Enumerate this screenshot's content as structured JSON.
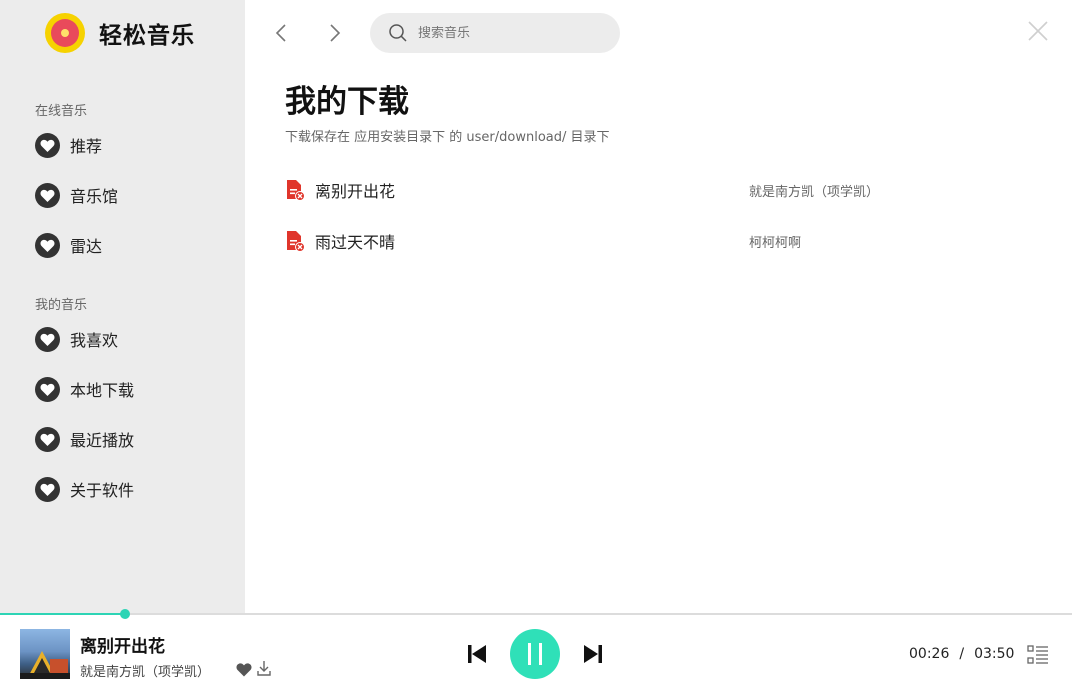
{
  "app": {
    "name": "轻松音乐"
  },
  "sidebar": {
    "online_section": "在线音乐",
    "online_items": [
      {
        "label": "推荐",
        "icon": "heart-icon"
      },
      {
        "label": "音乐馆",
        "icon": "heart-icon"
      },
      {
        "label": "雷达",
        "icon": "heart-icon"
      }
    ],
    "my_section": "我的音乐",
    "my_items": [
      {
        "label": "我喜欢",
        "icon": "heart-icon"
      },
      {
        "label": "本地下载",
        "icon": "heart-icon"
      },
      {
        "label": "最近播放",
        "icon": "heart-icon"
      },
      {
        "label": "关于软件",
        "icon": "heart-icon"
      }
    ]
  },
  "search": {
    "placeholder": "搜索音乐"
  },
  "main": {
    "title": "我的下载",
    "subtitle": "下载保存在 应用安装目录下 的 user/download/ 目录下",
    "songs": [
      {
        "title": "离别开出花",
        "artist": "就是南方凯（项学凯）"
      },
      {
        "title": "雨过天不晴",
        "artist": "柯柯柯啊"
      }
    ]
  },
  "player": {
    "title": "离别开出花",
    "artist": "就是南方凯（项学凯）",
    "current_time": "00:26",
    "separator": "/",
    "total_time": "03:50",
    "progress": 0.117,
    "state": "playing"
  },
  "colors": {
    "accent": "#2fe0b8",
    "sidebar_bg": "#ececec",
    "file_icon": "#e0352b"
  }
}
